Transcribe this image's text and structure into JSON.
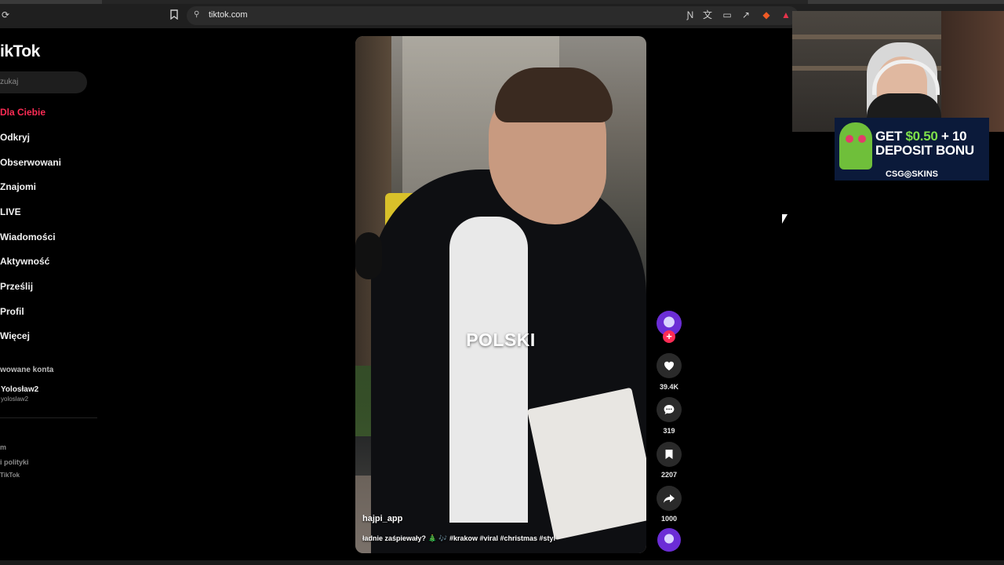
{
  "browser": {
    "url": "tiktok.com"
  },
  "sidebar": {
    "logo": "ikTok",
    "search_placeholder": "zukaj",
    "nav": [
      {
        "label": "Dla Ciebie",
        "active": true
      },
      {
        "label": "Odkryj"
      },
      {
        "label": "Obserwowani"
      },
      {
        "label": "Znajomi"
      },
      {
        "label": "LIVE"
      },
      {
        "label": "Wiadomości"
      },
      {
        "label": "Aktywność"
      },
      {
        "label": "Prześlij"
      },
      {
        "label": "Profil"
      },
      {
        "label": "Więcej"
      }
    ],
    "section_title": "wowane konta",
    "account": {
      "name": "Yolosław2",
      "handle": "yoloslaw2"
    },
    "footer": [
      "m",
      "i polityki",
      "TikTok"
    ]
  },
  "video": {
    "overlay_text": "POLSKI",
    "username": "hajpi_app",
    "caption": "ładnie zaśpiewały? 🎄 🎶 #krakow #viral #christmas #styl"
  },
  "actions": {
    "likes": "39.4K",
    "comments": "319",
    "saves": "2207",
    "shares": "1000"
  },
  "ad": {
    "line1_prefix": "GET ",
    "line1_amount": "$0.50",
    "line1_suffix": " + 10",
    "line2": "DEPOSIT BONU",
    "brand": "CSG◎SKINS"
  },
  "colors": {
    "accent": "#fe2c55",
    "background": "#000000"
  }
}
